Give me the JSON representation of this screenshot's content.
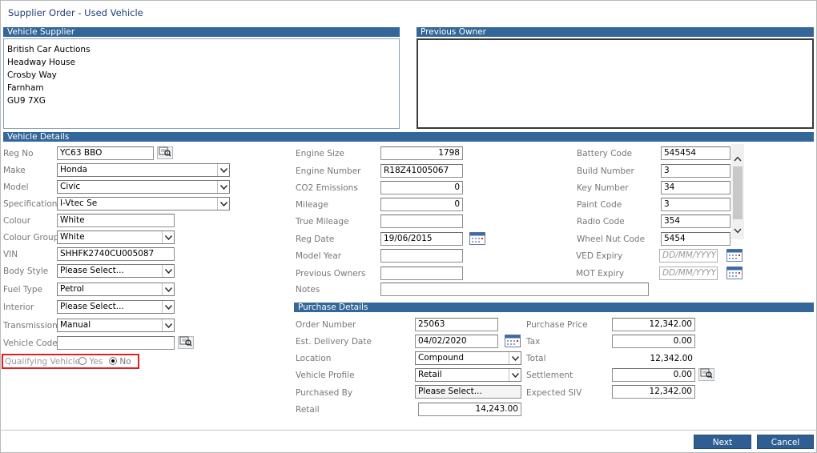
{
  "window": {
    "title": "Supplier Order - Used Vehicle"
  },
  "supplier": {
    "header": "Vehicle Supplier",
    "lines": [
      "British Car Auctions",
      "Headway House",
      "Crosby Way",
      "Farnham",
      "GU9 7XG"
    ]
  },
  "previous_owner": {
    "header": "Previous Owner"
  },
  "vehicle": {
    "header": "Vehicle Details",
    "reg_no": {
      "label": "Reg No",
      "value": "YC63 BBO"
    },
    "make": {
      "label": "Make",
      "value": "Honda"
    },
    "model": {
      "label": "Model",
      "value": "Civic"
    },
    "specification": {
      "label": "Specification",
      "value": "I-Vtec Se"
    },
    "colour": {
      "label": "Colour",
      "value": "White"
    },
    "colour_group": {
      "label": "Colour Group",
      "value": "White"
    },
    "vin": {
      "label": "VIN",
      "value": "SHHFK2740CU005087"
    },
    "body_style": {
      "label": "Body Style",
      "value": "Please Select..."
    },
    "fuel_type": {
      "label": "Fuel Type",
      "value": "Petrol"
    },
    "interior": {
      "label": "Interior",
      "value": "Please Select..."
    },
    "transmission": {
      "label": "Transmission",
      "value": "Manual"
    },
    "vehicle_code": {
      "label": "Vehicle Code",
      "value": ""
    },
    "qualifying": {
      "label": "Qualifying Vehicle",
      "yes": "Yes",
      "no": "No",
      "selected": "No"
    },
    "engine_size": {
      "label": "Engine Size",
      "value": "1798"
    },
    "engine_number": {
      "label": "Engine Number",
      "value": "R18Z41005067"
    },
    "co2": {
      "label": "CO2 Emissions",
      "value": "0"
    },
    "mileage": {
      "label": "Mileage",
      "value": "0"
    },
    "true_mileage": {
      "label": "True Mileage",
      "value": ""
    },
    "reg_date": {
      "label": "Reg Date",
      "value": "19/06/2015"
    },
    "model_year": {
      "label": "Model Year",
      "value": ""
    },
    "previous_owners": {
      "label": "Previous Owners",
      "value": ""
    },
    "notes": {
      "label": "Notes",
      "value": ""
    },
    "battery_code": {
      "label": "Battery Code",
      "value": "545454"
    },
    "build_number": {
      "label": "Build Number",
      "value": "3"
    },
    "key_number": {
      "label": "Key Number",
      "value": "34"
    },
    "paint_code": {
      "label": "Paint Code",
      "value": "3"
    },
    "radio_code": {
      "label": "Radio Code",
      "value": "354"
    },
    "wheel_nut_code": {
      "label": "Wheel Nut Code",
      "value": "5454"
    },
    "ved_expiry": {
      "label": "VED Expiry",
      "placeholder": "DD/MM/YYYY"
    },
    "mot_expiry": {
      "label": "MOT Expiry",
      "placeholder": "DD/MM/YYYY"
    }
  },
  "purchase": {
    "header": "Purchase Details",
    "order_number": {
      "label": "Order Number",
      "value": "25063"
    },
    "est_delivery": {
      "label": "Est. Delivery Date",
      "value": "04/02/2020"
    },
    "location": {
      "label": "Location",
      "value": "Compound"
    },
    "vehicle_profile": {
      "label": "Vehicle Profile",
      "value": "Retail"
    },
    "purchased_by": {
      "label": "Purchased By",
      "value": "Please Select..."
    },
    "retail": {
      "label": "Retail",
      "value": "14,243.00"
    },
    "purchase_price": {
      "label": "Purchase Price",
      "value": "12,342.00"
    },
    "tax": {
      "label": "Tax",
      "value": "0.00"
    },
    "total": {
      "label": "Total",
      "value": "12,342.00"
    },
    "settlement": {
      "label": "Settlement",
      "value": "0.00"
    },
    "expected_siv": {
      "label": "Expected SIV",
      "value": "12,342.00"
    }
  },
  "buttons": {
    "next": "Next",
    "cancel": "Cancel"
  },
  "colors": {
    "header_bg": "#336699",
    "title": "#1f3f7a",
    "highlight": "#e02020",
    "button_bg": "#2f5f92"
  }
}
